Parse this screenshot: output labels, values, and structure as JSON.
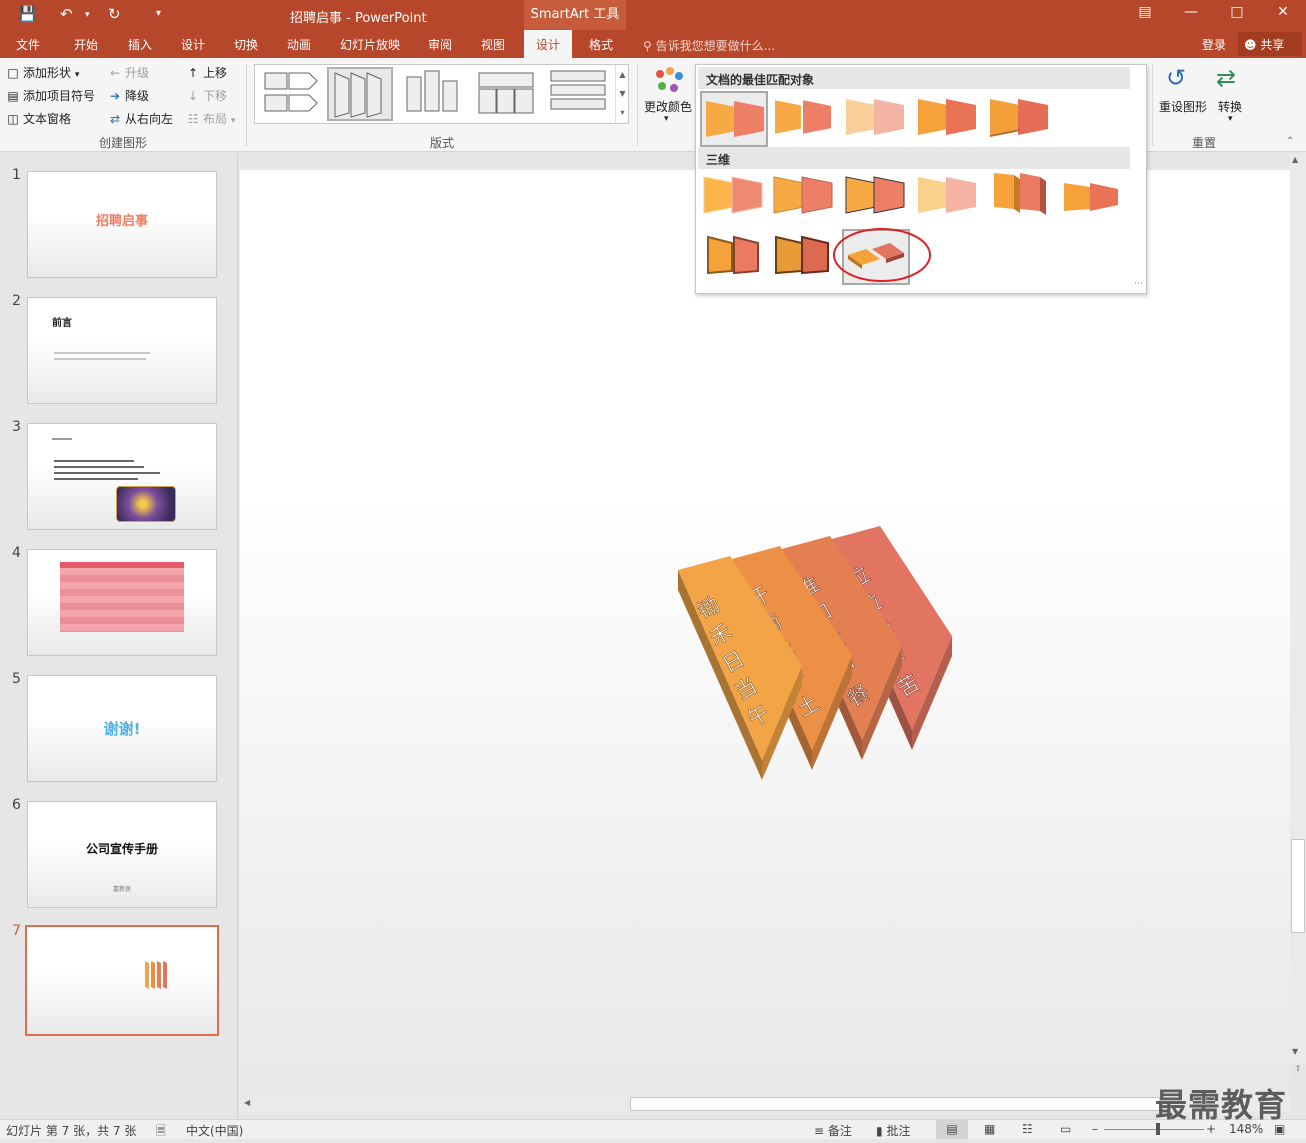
{
  "titlebar": {
    "title": "招聘启事 - PowerPoint",
    "contextual": "SmartArt 工具"
  },
  "tabs": [
    {
      "label": "文件"
    },
    {
      "label": "开始"
    },
    {
      "label": "插入"
    },
    {
      "label": "设计"
    },
    {
      "label": "切换"
    },
    {
      "label": "动画"
    },
    {
      "label": "幻灯片放映"
    },
    {
      "label": "审阅"
    },
    {
      "label": "视图"
    },
    {
      "label": "设计"
    },
    {
      "label": "格式"
    }
  ],
  "tellme": "告诉我您想要做什么...",
  "account": {
    "login": "登录",
    "share": "共享"
  },
  "ribbon": {
    "create": {
      "add_shape": "添加形状",
      "add_bullet": "添加项目符号",
      "text_pane": "文本窗格",
      "promote": "升级",
      "demote": "降级",
      "rtl": "从右向左",
      "move_up": "上移",
      "move_down": "下移",
      "layout": "布局",
      "group": "创建图形"
    },
    "layouts_group": "版式",
    "change_colors": "更改颜色",
    "reset_graphic": "重设图形",
    "convert": "转换",
    "reset_group": "重置"
  },
  "style_dropdown": {
    "section1": "文档的最佳匹配对象",
    "section2": "三维"
  },
  "slides": [
    {
      "num": "1",
      "title": "招聘启事"
    },
    {
      "num": "2",
      "title": "前言"
    },
    {
      "num": "3",
      "title": ""
    },
    {
      "num": "4",
      "title": ""
    },
    {
      "num": "5",
      "title": "谢谢!"
    },
    {
      "num": "6",
      "title": "公司宣传手册",
      "sub": "嘉新居"
    },
    {
      "num": "7",
      "title": ""
    }
  ],
  "smartart": {
    "items": [
      "锄禾日当午",
      "汗滴禾下土",
      "谁知盘中餐",
      "粒粒皆辛苦"
    ],
    "colors": [
      "#f2a447",
      "#ec9046",
      "#e47f52",
      "#e27462"
    ]
  },
  "status": {
    "slide_info": "幻灯片 第 7 张，共 7 张",
    "language": "中文(中国)",
    "notes": "备注",
    "comments": "批注",
    "zoom": "148%"
  },
  "watermark": "最需教育"
}
